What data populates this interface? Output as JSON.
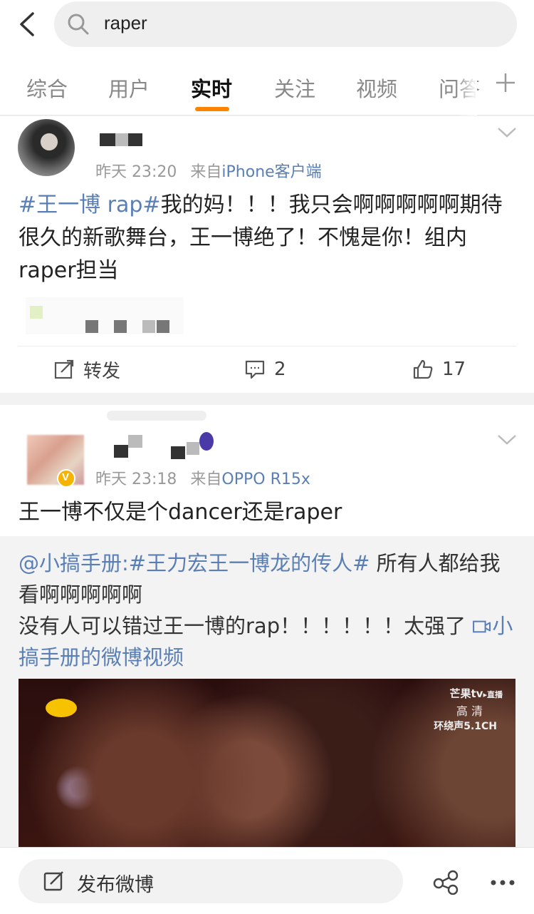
{
  "search": {
    "query": "raper"
  },
  "tabs": [
    {
      "label": "综合"
    },
    {
      "label": "用户"
    },
    {
      "label": "实时",
      "active": true
    },
    {
      "label": "关注"
    },
    {
      "label": "视频"
    },
    {
      "label": "问答"
    }
  ],
  "colors": {
    "accent": "#ff8200",
    "link": "#5a7fb6",
    "verified": "#f5b400"
  },
  "posts": [
    {
      "time": "昨天 23:20",
      "from_prefix": "来自",
      "source": "iPhone客户端",
      "text_tag": "#王一博 rap#",
      "text_body": "我的妈！！！我只会啊啊啊啊啊期待很久的新歌舞台，王一博绝了！不愧是你！组内raper担当",
      "actions": {
        "repost_label": "转发",
        "comment_count": "2",
        "like_count": "17"
      }
    },
    {
      "time": "昨天 23:18",
      "from_prefix": "来自",
      "source": "OPPO R15x",
      "text": "王一博不仅是个dancer还是raper",
      "repost": {
        "mention": "@小搞手册",
        "colon": ":",
        "tag": "#王力宏王一博龙的传人#",
        "body": " 所有人都给我看啊啊啊啊啊\n没有人可以错过王一博的rap！！！！！！太强了 ",
        "video_link": "小搞手册的微博视频"
      },
      "video": {
        "watermark_brand": "芒果tv",
        "watermark_live": "▸直播",
        "watermark_quality": "高 清",
        "watermark_audio": "环绕声5.1CH"
      }
    }
  ],
  "bottombar": {
    "compose_label": "发布微博",
    "icons": [
      "edit-icon",
      "share-icon",
      "more-icon"
    ]
  }
}
